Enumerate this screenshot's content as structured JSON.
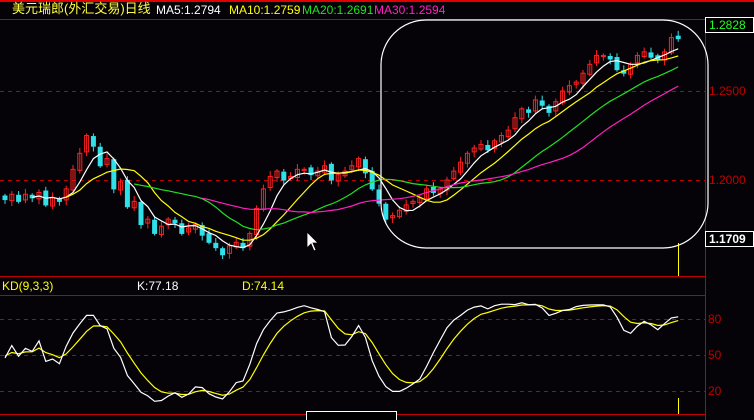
{
  "header": {
    "title": "美元瑞郎(外汇交易)日线",
    "ma5": "MA5:1.2794",
    "ma10": "MA10:1.2759",
    "ma20": "MA20:1.2691",
    "ma30": "MA30:1.2594"
  },
  "price_axis": {
    "ticks": [
      "1.2500",
      "1.2000"
    ],
    "high_label": "1.2828",
    "low_label": "1.1709"
  },
  "kd_panel": {
    "title": "KD(9,3,3)",
    "k_label": "K:77.18",
    "d_label": "D:74.14",
    "ticks": [
      "80",
      "50",
      "20"
    ]
  },
  "colors": {
    "up": "#ff2020",
    "down": "#30e0e8",
    "ma5": "#ffffff",
    "ma10": "#ffff00",
    "ma20": "#20e020",
    "ma30": "#ff20c0",
    "axis": "#c00000"
  },
  "chart_data": {
    "type": "candlestick",
    "title": "美元瑞郎(外汇交易)日线",
    "ylim": [
      1.155,
      1.287
    ],
    "price_ticks": [
      1.25,
      1.2
    ],
    "close": [
      1.189,
      1.192,
      1.188,
      1.192,
      1.19,
      1.193,
      1.186,
      1.19,
      1.188,
      1.195,
      1.206,
      1.215,
      1.225,
      1.219,
      1.208,
      1.212,
      1.195,
      1.199,
      1.185,
      1.188,
      1.175,
      1.178,
      1.17,
      1.174,
      1.178,
      1.176,
      1.17,
      1.173,
      1.175,
      1.169,
      1.165,
      1.162,
      1.158,
      1.163,
      1.165,
      1.162,
      1.17,
      1.184,
      1.195,
      1.202,
      1.205,
      1.2,
      1.202,
      1.206,
      1.206,
      1.203,
      1.205,
      1.208,
      1.2,
      1.203,
      1.205,
      1.208,
      1.212,
      1.204,
      1.195,
      1.187,
      1.178,
      1.18,
      1.183,
      1.186,
      1.188,
      1.19,
      1.195,
      1.193,
      1.195,
      1.2,
      1.205,
      1.21,
      1.215,
      1.218,
      1.22,
      1.217,
      1.222,
      1.225,
      1.228,
      1.235,
      1.24,
      1.238,
      1.245,
      1.242,
      1.238,
      1.244,
      1.25,
      1.253,
      1.255,
      1.26,
      1.265,
      1.27,
      1.27,
      1.268,
      1.262,
      1.26,
      1.265,
      1.27,
      1.272,
      1.269,
      1.268,
      1.272,
      1.28,
      1.2794
    ],
    "moving_averages": [
      5,
      10,
      20,
      30
    ],
    "kd_params": [
      9,
      3,
      3
    ],
    "kd_ylim": [
      0,
      100
    ],
    "kd_ticks": [
      80,
      50,
      20
    ],
    "last_k": 77.18,
    "last_d": 74.14
  }
}
